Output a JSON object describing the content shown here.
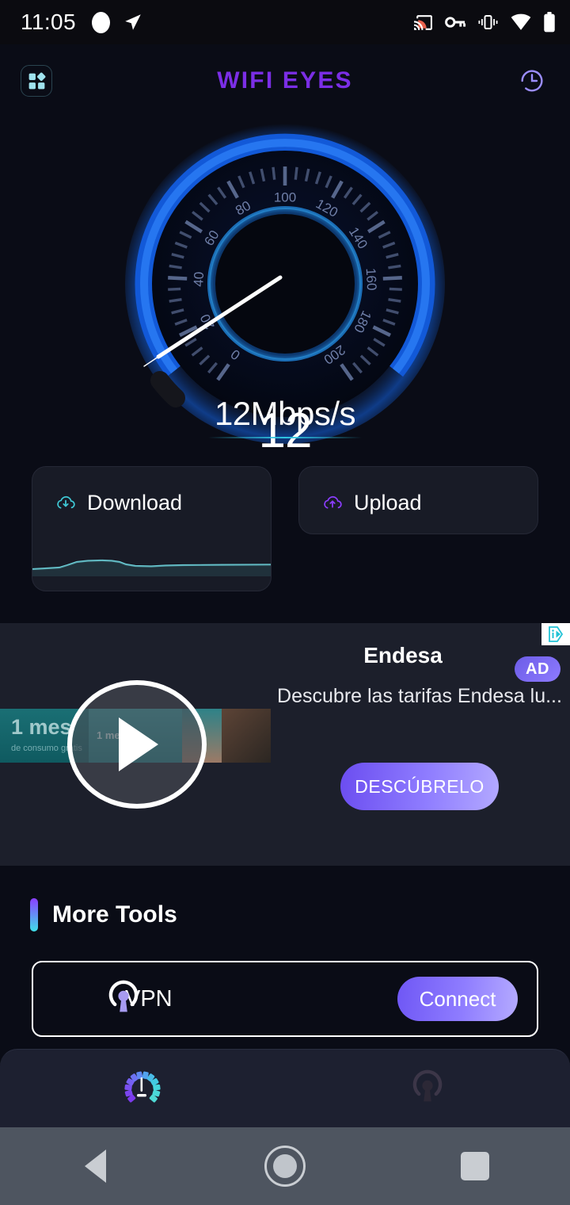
{
  "statusbar": {
    "time": "11:05",
    "icons_left": [
      "record-dot-icon",
      "navigation-arrow-icon"
    ],
    "icons_right": [
      "cast-icon",
      "vpn-key-icon",
      "vibrate-icon",
      "wifi-icon",
      "battery-icon"
    ],
    "cast_color": "#E8604C"
  },
  "appbar": {
    "title": "WIFI EYES",
    "title_color": "#7B2EE6",
    "left_icon": "apps-grid-icon",
    "right_icon": "history-clock-icon"
  },
  "gauge": {
    "value": "12",
    "unit_text": "12Mbps/s",
    "ticks": [
      "0",
      "20",
      "40",
      "60",
      "80",
      "100",
      "120",
      "140",
      "160",
      "180",
      "200"
    ],
    "min": 0,
    "max": 200,
    "current": 12,
    "arc_color": "#1464E6",
    "needle_color": "#FFFFFF"
  },
  "speed_cards": [
    {
      "label": "Download",
      "icon": "cloud-download-icon",
      "color": "#3FC9D6",
      "has_sparkline": true
    },
    {
      "label": "Upload",
      "icon": "cloud-upload-icon",
      "color": "#8B3DFF",
      "has_sparkline": false
    }
  ],
  "ad": {
    "advertiser": "Endesa",
    "description": "Descubre las tarifas Endesa lu...",
    "badge": "AD",
    "cta": "DESCÚBRELO",
    "play_icon": "play-button-icon",
    "adchoices_icon": "adchoices-icon",
    "thumb_text_main": "1 mes",
    "thumb_text_sub": "de consumo gratis",
    "thumb_text_small": "1 mes"
  },
  "more_tools": {
    "title": "More Tools",
    "items": [
      {
        "label": "VPN",
        "icon": "openvpn-shield-icon",
        "action": "Connect"
      }
    ]
  },
  "bottom_nav": [
    {
      "name": "speedtest",
      "icon": "speedometer-icon",
      "active": true
    },
    {
      "name": "vpn",
      "icon": "openvpn-shield-icon",
      "active": false
    }
  ],
  "android_nav": [
    "back-button",
    "home-button",
    "recents-button"
  ]
}
